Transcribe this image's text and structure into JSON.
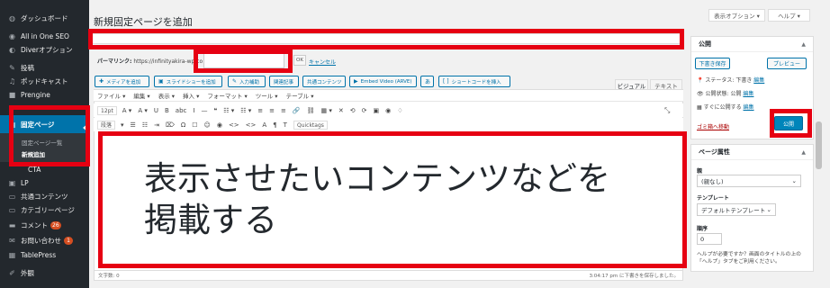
{
  "sidebar": {
    "items": [
      {
        "label": "ダッシュボード",
        "icon": "dashboard-icon",
        "glyph": "◍"
      },
      {
        "label": "All in One SEO",
        "icon": "seo-icon",
        "glyph": "◉"
      },
      {
        "label": "Diverオプション",
        "icon": "diver-icon",
        "glyph": "◐"
      },
      {
        "label": "投稿",
        "icon": "pin-icon",
        "glyph": "✎"
      },
      {
        "label": "ポッドキャスト",
        "icon": "podcast-icon",
        "glyph": "♫"
      },
      {
        "label": "Prengine",
        "icon": "prengine-icon",
        "glyph": "■"
      },
      {
        "label": "固定ページ",
        "icon": "page-icon",
        "glyph": "▤"
      },
      {
        "label": "LP",
        "icon": "lp-icon",
        "glyph": "▣"
      },
      {
        "label": "共通コンテンツ",
        "icon": "common-content-icon",
        "glyph": "▭"
      },
      {
        "label": "カテゴリーページ",
        "icon": "category-page-icon",
        "glyph": "▭"
      },
      {
        "label": "コメント",
        "icon": "comment-icon",
        "glyph": "▬",
        "badge": "26"
      },
      {
        "label": "お問い合わせ",
        "icon": "mail-icon",
        "glyph": "✉",
        "badge": "1"
      },
      {
        "label": "TablePress",
        "icon": "tablepress-icon",
        "glyph": "▦"
      },
      {
        "label": "外観",
        "icon": "appearance-icon",
        "glyph": "✐"
      }
    ],
    "submenu": [
      "固定ページ一覧",
      "新規追加"
    ],
    "cropped_label": "CTA"
  },
  "header": {
    "page_title": "新規固定ページを追加",
    "screen_options": "表示オプション ▾",
    "help": "ヘルプ ▾"
  },
  "permalink": {
    "label": "パーマリンク:",
    "url": "https://infinityakira-wp.co",
    "ok": "OK",
    "cancel": "キャンセル"
  },
  "media_buttons": [
    {
      "label": "メディアを追加",
      "glyph": "✚"
    },
    {
      "label": "スライドショーを追加",
      "glyph": "▣"
    },
    {
      "label": "入力補助",
      "glyph": "✎"
    },
    {
      "label": "関連記事",
      "glyph": ""
    },
    {
      "label": "共通コンテンツ",
      "glyph": ""
    },
    {
      "label": "Embed Video (ARVE)",
      "glyph": "▶"
    },
    {
      "label": "",
      "glyph": "あ"
    },
    {
      "label": "ショートコードを挿入",
      "glyph": "[ ]"
    }
  ],
  "editor": {
    "tabs": [
      "ビジュアル",
      "テキスト"
    ],
    "menubar": [
      "ファイル ▾",
      "編集 ▾",
      "表示 ▾",
      "挿入 ▾",
      "フォーマット ▾",
      "ツール ▾",
      "テーブル ▾"
    ],
    "font_size": "12pt",
    "paragraph": "段落",
    "quicktags": "Quicktags",
    "toolbar1": [
      "A ▾",
      "A ▾",
      "U",
      "B",
      "abc",
      "I",
      "—",
      "❝",
      "☷ ▾",
      "☷ ▾",
      "≡",
      "≡",
      "≡",
      "🔗",
      "⛓",
      "▦ ▾",
      "✕",
      "⟲",
      "⟳",
      "▣",
      "◉",
      "♢"
    ],
    "toolbar2": [
      "▾",
      "☰",
      "☷",
      "⇥",
      "⌦",
      "Ω",
      "☐",
      "☺",
      "◉",
      "<>",
      "<>",
      "A",
      "¶",
      "T"
    ],
    "content": [
      "表示させたいコンテンツなどを",
      "掲載する"
    ],
    "word_count": "文字数: 0",
    "saved_at": "3:04:17 pm に下書きを保存しました。"
  },
  "publish_box": {
    "title": "公開",
    "save_draft": "下書き保存",
    "preview": "プレビュー",
    "status": "ステータス: 下書き",
    "visibility": "公開状態: 公開",
    "schedule": "すぐに公開する",
    "edit": "編集",
    "trash": "ゴミ箱へ移動",
    "publish": "公開"
  },
  "attributes_box": {
    "title": "ページ属性",
    "parent_label": "親",
    "parent_value": "(親なし)",
    "template_label": "テンプレート",
    "template_value": "デフォルトテンプレート",
    "order_label": "順序",
    "order_value": "0",
    "help": "ヘルプが必要ですか？画面のタイトルの上の「ヘルプ」タブをご利用ください。"
  },
  "colors": {
    "sidebar_bg": "#23282d",
    "accent": "#0073aa",
    "highlight_red": "#e60012"
  }
}
